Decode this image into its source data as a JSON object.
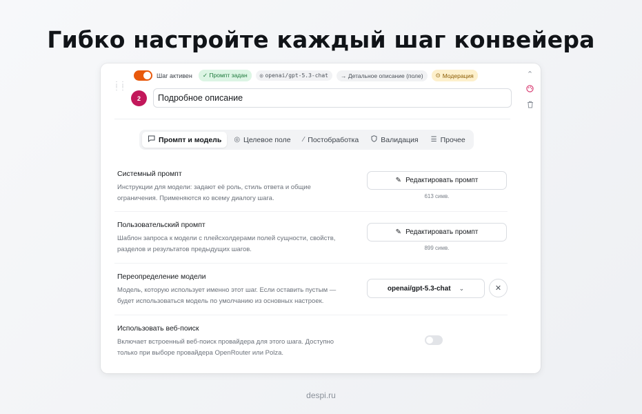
{
  "headline": "Гибко настройте каждый шаг конвейера",
  "step": {
    "active_label": "Шаг активен",
    "active": true,
    "chips": {
      "prompt_set": "✓ Промпт задан",
      "model": "openai/gpt-5.3-chat",
      "target": "→ Детальное описание (поле)",
      "moderation": "Модерация"
    },
    "number": "2",
    "name": "Подробное описание"
  },
  "tabs": [
    {
      "label": "Промпт и модель",
      "icon": "chat-icon"
    },
    {
      "label": "Целевое поле",
      "icon": "target-icon"
    },
    {
      "label": "Постобработка",
      "icon": "wand-icon"
    },
    {
      "label": "Валидация",
      "icon": "shield-icon"
    },
    {
      "label": "Прочее",
      "icon": "sliders-icon"
    }
  ],
  "sections": {
    "system_prompt": {
      "title": "Системный промпт",
      "desc": "Инструкции для модели: задают её роль, стиль ответа и общие ограничения. Применяются ко всему диалогу шага.",
      "button": "Редактировать промпт",
      "count": "613 симв."
    },
    "user_prompt": {
      "title": "Пользовательский промпт",
      "desc": "Шаблон запроса к модели с плейсхолдерами полей сущности, свойств, разделов и результатов предыдущих шагов.",
      "button": "Редактировать промпт",
      "count": "899 симв."
    },
    "model_override": {
      "title": "Переопределение модели",
      "desc": "Модель, которую использует именно этот шаг. Если оставить пустым — будет использоваться модель по умолчанию из основных настроек.",
      "value": "openai/gpt-5.3-chat"
    },
    "web_search": {
      "title": "Использовать веб-поиск",
      "desc": "Включает встроенный веб-поиск провайдера для этого шага. Доступно только при выборе провайдера OpenRouter или Polza.",
      "enabled": false
    }
  },
  "footer": "despi.ru",
  "colors": {
    "accent": "#e8590c",
    "step_badge": "#c2185b",
    "chip_green": "#dcf5e4",
    "chip_amber": "#fdf0cc"
  }
}
